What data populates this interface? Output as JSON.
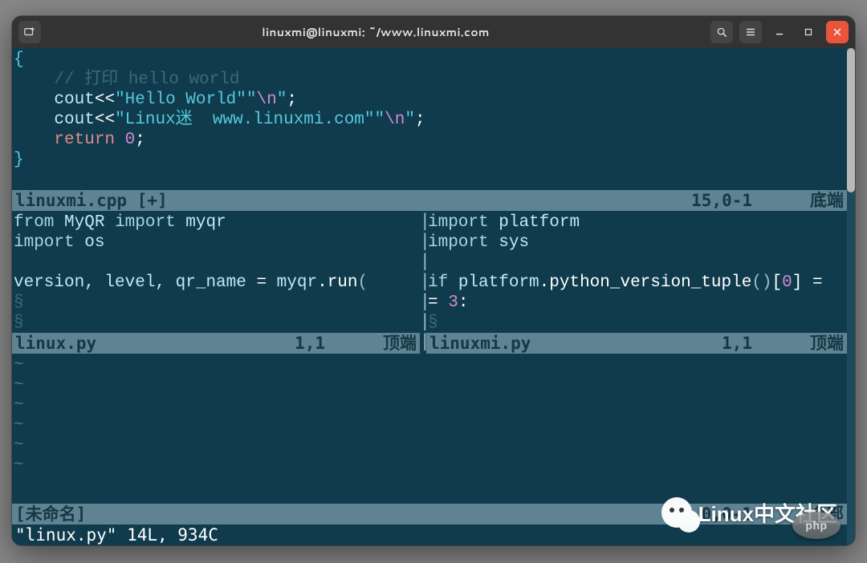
{
  "titlebar": {
    "title": "linuxmi@linuxmi: ~/www.linuxmi.com"
  },
  "top_pane": {
    "code": {
      "l1_brace": "{",
      "l2_indent": "    ",
      "l2_comment": "// 打印 hello world",
      "l3_indent": "    ",
      "l3_ident": "cout",
      "l3_op1": "<<",
      "l3_str": "\"Hello World\"",
      "l3_str2": "\"",
      "l3_esc": "\\n",
      "l3_str3": "\"",
      "l3_semi": ";",
      "l4_indent": "    ",
      "l4_ident": "cout",
      "l4_op1": "<<",
      "l4_str": "\"Linux迷  www.linuxmi.com\"",
      "l4_str2": "\"",
      "l4_esc": "\\n",
      "l4_str3": "\"",
      "l4_semi": ";",
      "l5_indent": "    ",
      "l5_ret": "return",
      "l5_sp": " ",
      "l5_num": "0",
      "l5_semi": ";",
      "l6_brace": "}"
    },
    "status": {
      "file": "linuxmi.cpp [+]",
      "pos": "15,0-1",
      "rlab": "底端"
    }
  },
  "mid_left": {
    "code": {
      "l1_kw1": "from",
      "l1_sp1": " ",
      "l1_mod": "MyQR",
      "l1_sp2": " ",
      "l1_kw2": "import",
      "l1_sp3": " ",
      "l1_id": "myqr",
      "l2_kw": "import",
      "l2_sp": " ",
      "l2_id": "os",
      "l4_ids": "version, level, qr_name ",
      "l4_eq": "=",
      "l4_sp": " ",
      "l4_obj": "myqr",
      "l4_dot": ".",
      "l4_fn": "run",
      "l4_p": "("
    },
    "status": {
      "file": "linux.py",
      "pos": "1,1",
      "rlab": "顶端"
    }
  },
  "mid_right": {
    "code": {
      "l1_kw": "import",
      "l1_sp": " ",
      "l1_id": "platform",
      "l2_kw": "import",
      "l2_sp": " ",
      "l2_id": "sys",
      "l4_if": "if",
      "l4_sp1": " ",
      "l4_obj": "platform",
      "l4_dot": ".",
      "l4_fn": "python_version_tuple",
      "l4_par": "()",
      "l4_idx": "[",
      "l4_num": "0",
      "l4_idx2": "]",
      "l4_sp2": " ",
      "l4_eq": "=",
      "l5_eq": "=",
      "l5_sp": " ",
      "l5_num": "3",
      "l5_colon": ":"
    },
    "status": {
      "file": "linuxmi.py",
      "pos": "1,1",
      "rlab": "顶端"
    }
  },
  "bot_pane": {
    "status": {
      "file": "[未命名]",
      "pos": "0,0-1",
      "rlab": "全部"
    }
  },
  "cmdline": "\"linux.py\" 14L, 934C",
  "watermark": "Linux中文社区",
  "php_badge": "php",
  "tilde": "~",
  "vsep_char": "|"
}
